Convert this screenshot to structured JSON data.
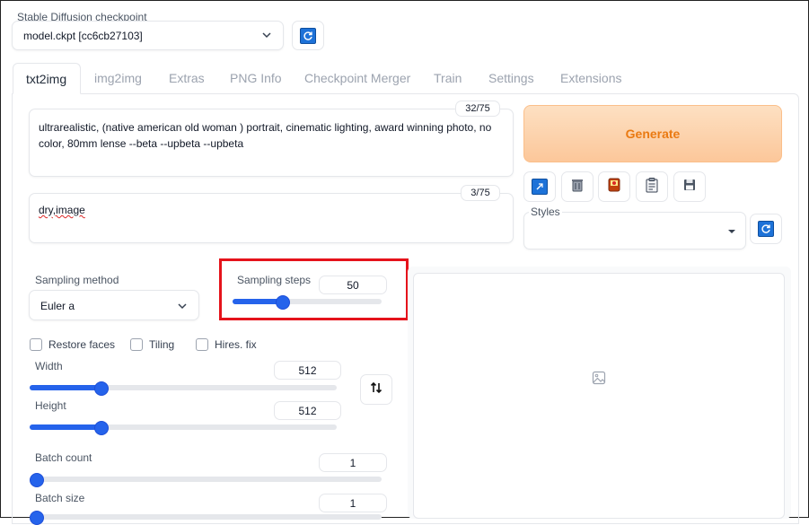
{
  "checkpoint": {
    "label": "Stable Diffusion checkpoint",
    "value": "model.ckpt [cc6cb27103]"
  },
  "tabs": [
    {
      "label": "txt2img",
      "active": true
    },
    {
      "label": "img2img"
    },
    {
      "label": "Extras"
    },
    {
      "label": "PNG Info"
    },
    {
      "label": "Checkpoint Merger"
    },
    {
      "label": "Train"
    },
    {
      "label": "Settings"
    },
    {
      "label": "Extensions"
    }
  ],
  "prompt": {
    "counter": "32/75",
    "text": "ultrarealistic, (native american old woman ) portrait, cinematic lighting, award winning photo, no color, 80mm lense --beta --upbeta --upbeta"
  },
  "negative_prompt": {
    "counter": "3/75",
    "text": "dry,image"
  },
  "generate_label": "Generate",
  "styles_label": "Styles",
  "sampling_method": {
    "label": "Sampling method",
    "value": "Euler a"
  },
  "sampling_steps": {
    "label": "Sampling steps",
    "value": "50",
    "fraction": 0.33
  },
  "checkboxes": {
    "restore_faces": "Restore faces",
    "tiling": "Tiling",
    "hires_fix": "Hires. fix"
  },
  "width": {
    "label": "Width",
    "value": "512",
    "fraction": 0.23
  },
  "height": {
    "label": "Height",
    "value": "512",
    "fraction": 0.23
  },
  "batch_count": {
    "label": "Batch count",
    "value": "1",
    "fraction": 0.0
  },
  "batch_size": {
    "label": "Batch size",
    "value": "1",
    "fraction": 0.0
  },
  "colors": {
    "accent": "#2563eb",
    "generate_bg": "#fdd3a8",
    "generate_text": "#ea7a12",
    "highlight": "#e5131b"
  },
  "icons": {
    "refresh": "refresh-icon",
    "swap": "swap-icon",
    "image_placeholder": "image-icon"
  }
}
